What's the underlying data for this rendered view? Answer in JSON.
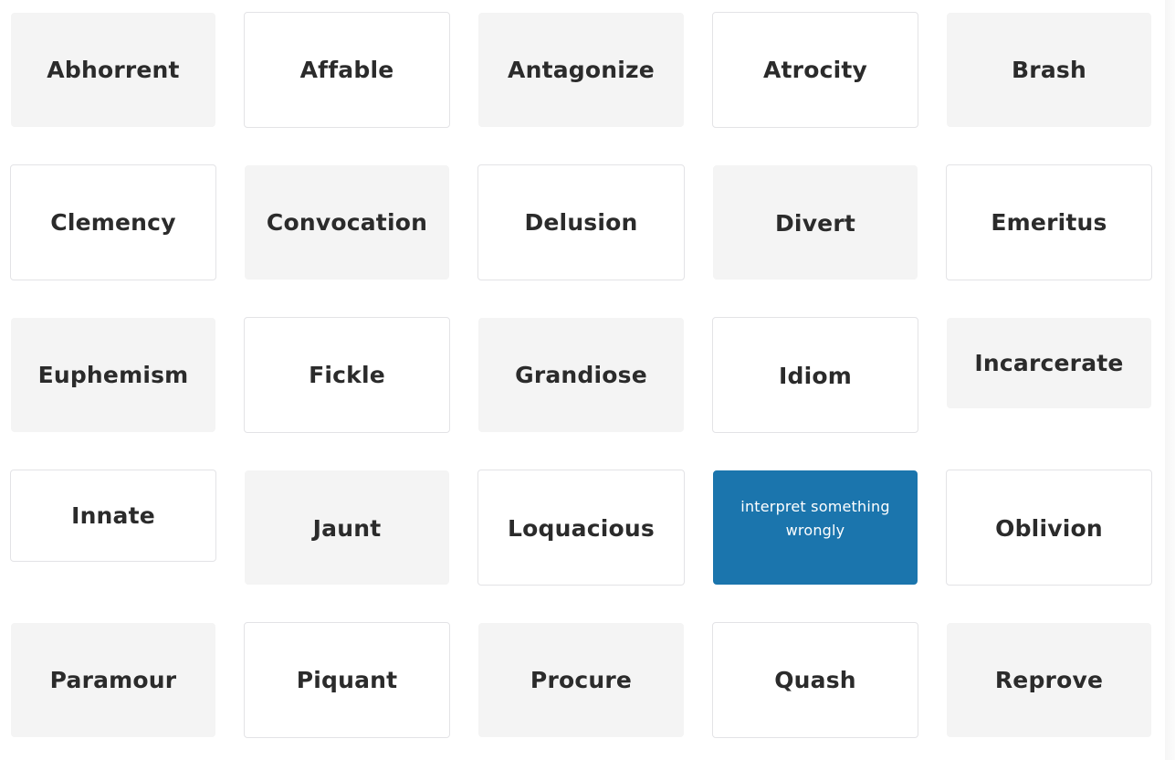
{
  "cards": [
    {
      "label": "Abhorrent",
      "style": "gray"
    },
    {
      "label": "Affable",
      "style": "white"
    },
    {
      "label": "Antagonize",
      "style": "gray"
    },
    {
      "label": "Atrocity",
      "style": "white"
    },
    {
      "label": "Brash",
      "style": "gray"
    },
    {
      "label": "Clemency",
      "style": "white"
    },
    {
      "label": "Convocation",
      "style": "gray"
    },
    {
      "label": "Delusion",
      "style": "white"
    },
    {
      "label": "Divert",
      "style": "gray"
    },
    {
      "label": "Emeritus",
      "style": "white"
    },
    {
      "label": "Euphemism",
      "style": "gray"
    },
    {
      "label": "Fickle",
      "style": "white"
    },
    {
      "label": "Grandiose",
      "style": "gray"
    },
    {
      "label": "Idiom",
      "style": "white"
    },
    {
      "label": "Incarcerate",
      "style": "gray"
    },
    {
      "label": "Innate",
      "style": "white"
    },
    {
      "label": "Jaunt",
      "style": "gray"
    },
    {
      "label": "Loquacious",
      "style": "white"
    },
    {
      "label": "interpret something wrongly",
      "style": "selected",
      "flipped": true
    },
    {
      "label": "Oblivion",
      "style": "white"
    },
    {
      "label": "Paramour",
      "style": "gray"
    },
    {
      "label": "Piquant",
      "style": "white"
    },
    {
      "label": "Procure",
      "style": "gray"
    },
    {
      "label": "Quash",
      "style": "white"
    },
    {
      "label": "Reprove",
      "style": "gray"
    }
  ],
  "colors": {
    "selected_bg": "#1b75ad",
    "gray_card_bg": "#f4f4f4",
    "text": "#2b2b2b"
  }
}
